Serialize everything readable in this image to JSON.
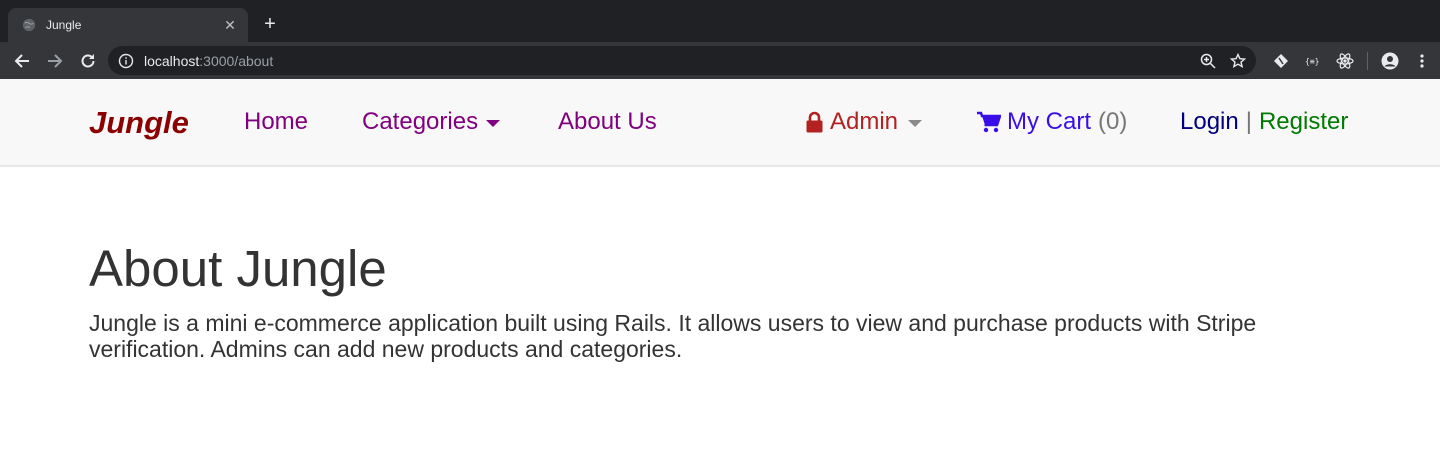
{
  "browser": {
    "tab_title": "Jungle",
    "tab_close": "✕",
    "new_tab": "+",
    "url_host": "localhost",
    "url_path": ":3000/about"
  },
  "nav": {
    "brand": "Jungle",
    "home": "Home",
    "categories": "Categories",
    "about": "About Us",
    "admin": "Admin",
    "cart_label": "My Cart",
    "cart_count": "(0)",
    "login": "Login",
    "separator": "|",
    "register": "Register"
  },
  "main": {
    "title": "About Jungle",
    "description": "Jungle is a mini e-commerce application built using Rails. It allows users to view and purchase products with Stripe verification. Admins can add new products and categories."
  },
  "icons": {
    "favicon": "globe-icon",
    "back": "back-arrow-icon",
    "forward": "forward-arrow-icon",
    "reload": "reload-icon",
    "site_info": "info-icon",
    "zoom": "zoom-icon",
    "bookmark": "star-icon",
    "extension_1": "git-extension-icon",
    "extension_2": "json-extension-icon",
    "extension_3": "react-devtools-icon",
    "profile": "profile-icon",
    "menu": "kebab-menu-icon",
    "lock": "lock-icon",
    "cart": "cart-icon"
  },
  "colors": {
    "brand": "#8b0000",
    "nav_link": "#800080",
    "admin": "#b22222",
    "cart": "#3a0ee6",
    "login": "#000080",
    "register": "#007a00",
    "navbar_bg": "#f8f8f8"
  }
}
